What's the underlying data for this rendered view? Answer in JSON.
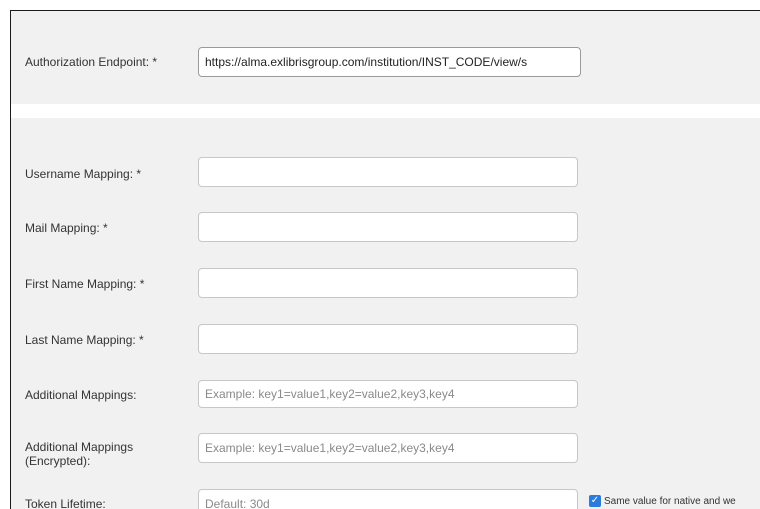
{
  "auth_endpoint": {
    "label": "Authorization Endpoint: *",
    "value": "https://alma.exlibrisgroup.com/institution/INST_CODE/view/s"
  },
  "mappings": {
    "username": {
      "label": "Username Mapping: *",
      "value": ""
    },
    "mail": {
      "label": "Mail Mapping: *",
      "value": ""
    },
    "first_name": {
      "label": "First Name Mapping: *",
      "value": ""
    },
    "last_name": {
      "label": "Last Name Mapping: *",
      "value": ""
    },
    "additional": {
      "label": "Additional Mappings:",
      "placeholder": "Example: key1=value1,key2=value2,key3,key4"
    },
    "additional_encrypted": {
      "label_line1": "Additional Mappings",
      "label_line2": "(Encrypted):",
      "placeholder": "Example: key1=value1,key2=value2,key3,key4"
    }
  },
  "token_lifetime": {
    "label": "Token Lifetime:",
    "placeholder": "Default: 30d",
    "checkbox_checked": true,
    "checkbox_label": "Same value for native and we"
  },
  "colors": {
    "panel_bg": "#f1f1f1",
    "checkbox_accent": "#2a7bde"
  }
}
